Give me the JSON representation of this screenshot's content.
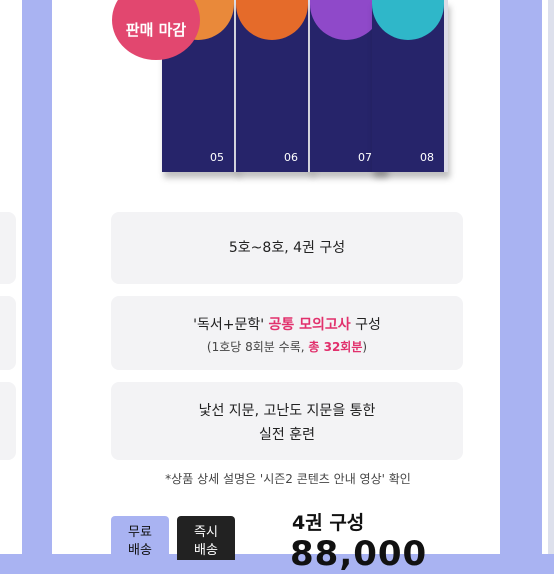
{
  "badge": {
    "label": "판매 마감"
  },
  "books": [
    {
      "number": "05",
      "cover_color": "#e9893a"
    },
    {
      "number": "06",
      "cover_color": "#e56b2a"
    },
    {
      "number": "07",
      "cover_color": "#8f49c9"
    },
    {
      "number": "08",
      "cover_color": "#2fb7c9"
    }
  ],
  "info": {
    "box1": "5호~8호, 4권 구성",
    "box2_line1_pre": "'독서+문학' ",
    "box2_line1_highlight": "공통 모의고사",
    "box2_line1_post": " 구성",
    "box2_line2_pre": "(1호당 8회분 수록, ",
    "box2_line2_highlight": "총 32회분",
    "box2_line2_post": ")",
    "box3_line1": "낯선 지문, 고난도 지문을 통한",
    "box3_line2": "실전 훈련"
  },
  "note": "*상품 상세 설명은 '시즌2 콘텐츠 안내 영상' 확인",
  "buttons": {
    "free_shipping": [
      "무료",
      "배송"
    ],
    "instant_shipping": [
      "즉시",
      "배송"
    ]
  },
  "product": {
    "title": "4권 구성",
    "price": "88,000"
  },
  "colors": {
    "background": "#a9b3f2",
    "accent": "#e1306c",
    "badge": "#e2476f"
  }
}
